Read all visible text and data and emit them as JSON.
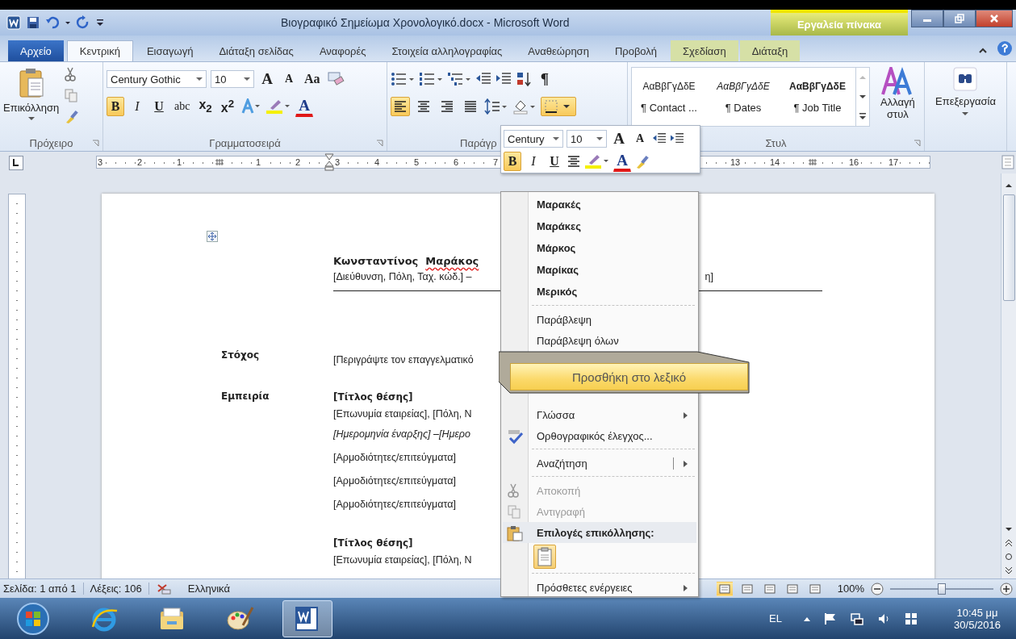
{
  "title_bar": {
    "title": "Βιογραφικό Σημείωμα Χρονολογικό.docx  -  Microsoft Word",
    "context_group": "Εργαλεία πίνακα"
  },
  "tabs": [
    {
      "label": "Αρχείο",
      "kind": "file",
      "selected": false
    },
    {
      "label": "Κεντρική",
      "kind": "tab",
      "selected": true
    },
    {
      "label": "Εισαγωγή",
      "kind": "tab",
      "selected": false
    },
    {
      "label": "Διάταξη σελίδας",
      "kind": "tab",
      "selected": false
    },
    {
      "label": "Αναφορές",
      "kind": "tab",
      "selected": false
    },
    {
      "label": "Στοιχεία αλληλογραφίας",
      "kind": "tab",
      "selected": false
    },
    {
      "label": "Αναθεώρηση",
      "kind": "tab",
      "selected": false
    },
    {
      "label": "Προβολή",
      "kind": "tab",
      "selected": false
    },
    {
      "label": "Σχεδίαση",
      "kind": "context",
      "selected": false
    },
    {
      "label": "Διάταξη",
      "kind": "context",
      "selected": false
    }
  ],
  "ribbon": {
    "clipboard": {
      "paste": "Επικόλληση",
      "label": "Πρόχειρο"
    },
    "font": {
      "name": "Century Gothic",
      "size": "10",
      "grow": "A",
      "shrink": "A",
      "case": "Aa",
      "color_letter": "A",
      "label": "Γραμματοσειρά",
      "buttons": [
        {
          "text": "B",
          "kind": "bold",
          "selected": true
        },
        {
          "text": "I",
          "kind": "italic",
          "selected": false
        },
        {
          "text": "U",
          "kind": "underline",
          "selected": false
        },
        {
          "text": "abc",
          "kind": "strike",
          "selected": false
        },
        {
          "text": "x$_{2}$",
          "kind": "script",
          "selected": false
        },
        {
          "text": "x$^{2}$",
          "kind": "script",
          "selected": false
        }
      ]
    },
    "paragraph": {
      "label": "Παράγρ",
      "pilcrow": "¶",
      "align": [
        {
          "selected": true
        },
        {
          "selected": false
        },
        {
          "selected": false
        },
        {
          "selected": false
        }
      ],
      "borders_selected": true
    },
    "styles": {
      "items": [
        {
          "sample": "ΑαΒβΓγΔδΕ",
          "name": "¶ Contact ...",
          "kind": "plain"
        },
        {
          "sample": "ΑαΒβΓγΔδΕ",
          "name": "¶ Dates",
          "kind": "italic"
        },
        {
          "sample": "ΑαΒβΓγΔδΕ",
          "name": "¶ Job Title",
          "kind": "bold"
        }
      ],
      "change": "Αλλαγή στυλ",
      "label": "Στυλ"
    },
    "editing": {
      "label": "Επεξεργασία"
    }
  },
  "ruler": [
    {
      "kind": "number",
      "text": "3"
    },
    {
      "kind": "number",
      "text": "2"
    },
    {
      "kind": "number",
      "text": "1"
    },
    {
      "kind": "marker"
    },
    {
      "kind": "number",
      "text": "1"
    },
    {
      "kind": "number",
      "text": "2"
    },
    {
      "kind": "number",
      "text": "3"
    },
    {
      "kind": "number",
      "text": "4"
    },
    {
      "kind": "number",
      "text": "5"
    },
    {
      "kind": "number",
      "text": "6"
    },
    {
      "kind": "number",
      "text": "7"
    },
    {
      "kind": "hidden"
    },
    {
      "kind": "hidden"
    },
    {
      "kind": "hidden"
    },
    {
      "kind": "hidden"
    },
    {
      "kind": "hidden"
    },
    {
      "kind": "number",
      "text": "13"
    },
    {
      "kind": "number",
      "text": "14"
    },
    {
      "kind": "marker"
    },
    {
      "kind": "number",
      "text": "16"
    },
    {
      "kind": "number",
      "text": "17"
    }
  ],
  "document": {
    "name": {
      "first": "Κωνσταντίνος",
      "last": "Μαράκος",
      "misspelled": true
    },
    "address_left": "[Διεύθυνση, Πόλη, Ταχ. κώδ.] –",
    "address_right": "η]",
    "sections": [
      {
        "heading": "Στόχος",
        "lines": [
          {
            "text": "[Περιγράψτε τον επαγγελματικό",
            "kind": "plain"
          }
        ]
      },
      {
        "heading": "Εμπειρία",
        "lines": [
          {
            "text": "[Τίτλος θέσης]",
            "kind": "title"
          },
          {
            "text": "[Επωνυμία εταιρείας], [Πόλη, Ν",
            "kind": "plain"
          },
          {
            "text": "[Ημερομηνία έναρξης] –[Ημερο",
            "kind": "date"
          },
          {
            "text": "[Αρμοδιότητες/επιτεύγματα]",
            "kind": "bullet"
          },
          {
            "text": "[Αρμοδιότητες/επιτεύγματα]",
            "kind": "bullet"
          },
          {
            "text": "[Αρμοδιότητες/επιτεύγματα]",
            "kind": "bullet"
          },
          {
            "text": "[Τίτλος θέσης]",
            "kind": "title"
          },
          {
            "text": "[Επωνυμία εταιρείας], [Πόλη, Ν",
            "kind": "plain"
          }
        ]
      }
    ]
  },
  "mini_toolbar": {
    "font": "Century",
    "size": "10",
    "grow": "A",
    "shrink": "A",
    "color_letter": "A",
    "buttons": [
      {
        "text": "B",
        "kind": "bold",
        "selected": true
      },
      {
        "text": "I",
        "kind": "italic",
        "selected": false
      },
      {
        "text": "U",
        "kind": "underline",
        "selected": false
      }
    ]
  },
  "context_menu": {
    "suggestions": [
      "Μαρακές",
      "Μαράκες",
      "Μάρκος",
      "Μαρίκας",
      "Μερικός"
    ],
    "ignore": [
      "Παράβλεψη",
      "Παράβλεψη όλων"
    ],
    "callout": "Προσθήκη στο λεξικό",
    "items": [
      {
        "label": "Γλώσσα",
        "kind": "submenu",
        "disabled": false
      },
      {
        "label": "Ορθογραφικός έλεγχος...",
        "kind": "spelling",
        "disabled": false
      },
      {
        "kind": "separator"
      },
      {
        "label": "Αναζήτηση",
        "kind": "split",
        "disabled": false
      },
      {
        "kind": "separator"
      },
      {
        "label": "Αποκοπή",
        "kind": "cut",
        "disabled": true
      },
      {
        "label": "Αντιγραφή",
        "kind": "copy",
        "disabled": true
      },
      {
        "label": "Επιλογές επικόλλησης:",
        "kind": "header",
        "disabled": false
      },
      {
        "kind": "paste_option"
      },
      {
        "kind": "separator"
      },
      {
        "label": "Πρόσθετες ενέργειες",
        "kind": "submenu",
        "disabled": false
      }
    ]
  },
  "status_bar": {
    "page": "Σελίδα: 1 από 1",
    "words": "Λέξεις: 106",
    "language": "Ελληνικά",
    "zoom": "100%",
    "zoom_slider": {
      "level": 0.5
    },
    "views": [
      {
        "selected": true
      },
      {
        "selected": false
      },
      {
        "selected": false
      },
      {
        "selected": false
      },
      {
        "selected": false
      }
    ]
  },
  "taskbar": {
    "apps": [
      {
        "kind": "browser",
        "selected": false
      },
      {
        "kind": "folder",
        "selected": false
      },
      {
        "kind": "paint",
        "selected": false
      },
      {
        "kind": "word",
        "selected": true
      }
    ],
    "language": "EL",
    "time": "10:45 μμ",
    "date": "30/5/2016"
  }
}
